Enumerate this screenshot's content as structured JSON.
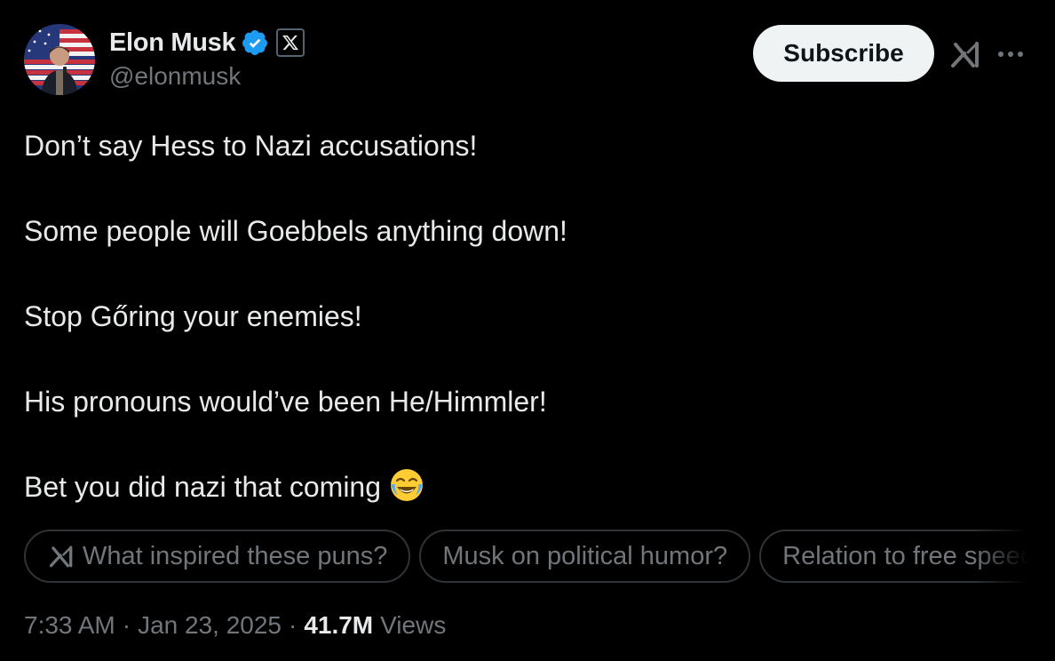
{
  "author": {
    "display_name": "Elon Musk",
    "handle": "@elonmusk",
    "verified_icon": "verified-badge-icon",
    "affiliation_icon": "x-logo-icon"
  },
  "header": {
    "subscribe_label": "Subscribe",
    "grok_icon": "grok-icon",
    "more_icon": "more-dots-icon"
  },
  "post": {
    "lines": [
      "Don’t say Hess to Nazi accusations!",
      "Some people will Goebbels anything down!",
      "Stop Gőring your enemies!",
      "His pronouns would’ve been He/Himmler!",
      "Bet you did nazi that coming"
    ],
    "emoji_icon": "face-with-tears-of-joy-icon"
  },
  "suggestions": [
    "What inspired these puns?",
    "Musk on political humor?",
    "Relation to free speech"
  ],
  "meta": {
    "time": "7:33 AM",
    "separator": "·",
    "date": "Jan 23, 2025",
    "views_count": "41.7M",
    "views_label": "Views"
  },
  "colors": {
    "background": "#000000",
    "text_primary": "#e7e9ea",
    "text_secondary": "#71767b",
    "verified_blue": "#1d9bf0",
    "subscribe_bg": "#eff3f4",
    "chip_border": "#2f3336"
  }
}
